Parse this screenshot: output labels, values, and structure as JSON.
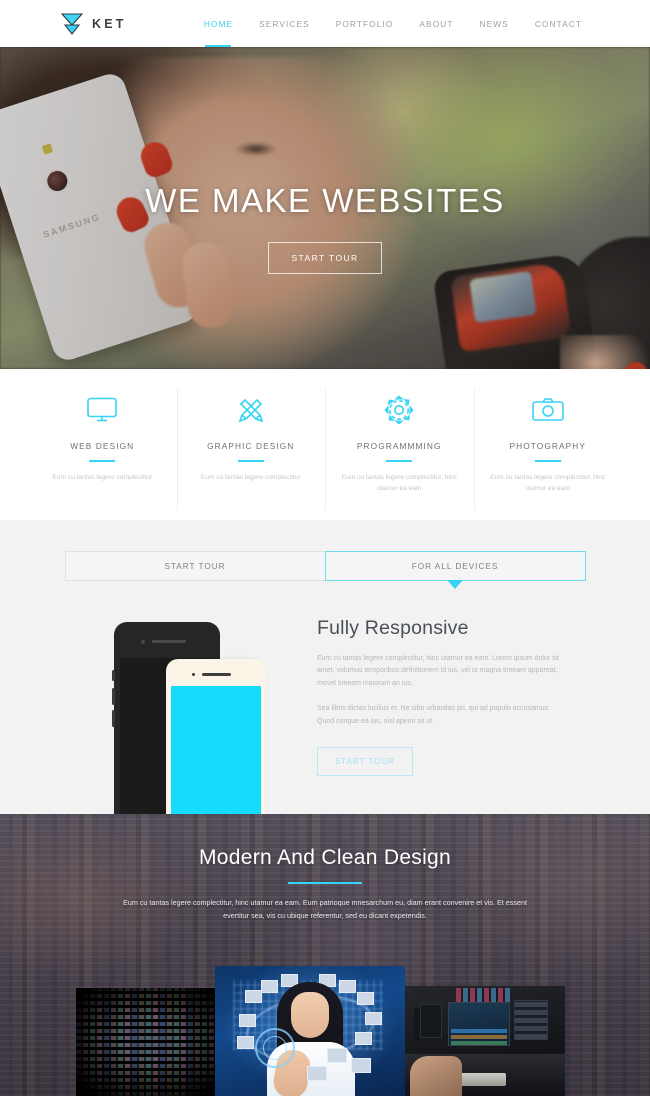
{
  "header": {
    "brand": {
      "name": "KET",
      "logo_icon": "triangle-hourglass-logo",
      "color": "#35d3f5"
    },
    "nav": [
      {
        "label": "HOME",
        "active": true
      },
      {
        "label": "SERVICES",
        "active": false
      },
      {
        "label": "PORTFOLIO",
        "active": false
      },
      {
        "label": "ABOUT",
        "active": false
      },
      {
        "label": "NEWS",
        "active": false
      },
      {
        "label": "CONTACT",
        "active": false
      }
    ]
  },
  "hero": {
    "title": "WE MAKE WEBSITES",
    "button_label": "START TOUR",
    "phone_brand_text": "SAMSUNG"
  },
  "services": [
    {
      "icon": "monitor-icon",
      "title": "WEB DESIGN",
      "desc": "Eum cu tantas legere complectitur"
    },
    {
      "icon": "pencil-ruler-icon",
      "title": "GRAPHIC DESIGN",
      "desc": "Eum cu tantas legere complectitur"
    },
    {
      "icon": "gear-icon",
      "title": "PROGRAMMMING",
      "desc": "Eum cu tantas legere complectitur, hinc utamur ea eam"
    },
    {
      "icon": "camera-icon",
      "title": "PHOTOGRAPHY",
      "desc": "Eum cu tantas legere complectitur, hinc utamur ea eam"
    }
  ],
  "responsive": {
    "tabs": [
      {
        "label": "START TOUR",
        "active": false
      },
      {
        "label": "FOR ALL DEVICES",
        "active": true
      }
    ],
    "title": "Fully Responsive",
    "paragraph_1": "Eum cu tantas legere complectitur, hinc utamur ea eam. Lorem ipsum dolor sit amet, volumus temporibus definitionem id ius, vel ut magna timeam appareat, movet timeam maiorum an ius.",
    "paragraph_2": "Sea libris dictas lucilius et. Ne cibo urbanitas pri, qui ad populo accusamus. Quod congue ea ius, nisl aperiri sit ut.",
    "button_label": "START TOUR"
  },
  "modern": {
    "title": "Modern And Clean Design",
    "paragraph": "Eum cu tantas legere complectitur, hinc utamur ea eam. Eum patrioque mnesarchum eu, diam erant convenire et vis. Et essent evertitur sea, vis cu ubique referentur, sed eu dicant expetendis.",
    "gallery": [
      {
        "name": "video-wall-thumbnail"
      },
      {
        "name": "tech-woman-thumbnail"
      },
      {
        "name": "editing-studio-thumbnail"
      }
    ]
  },
  "colors": {
    "accent": "#35d3f5",
    "text_dark": "#4b5057",
    "text_muted": "#b3b8bd",
    "section_gray": "#f2f2f2"
  }
}
